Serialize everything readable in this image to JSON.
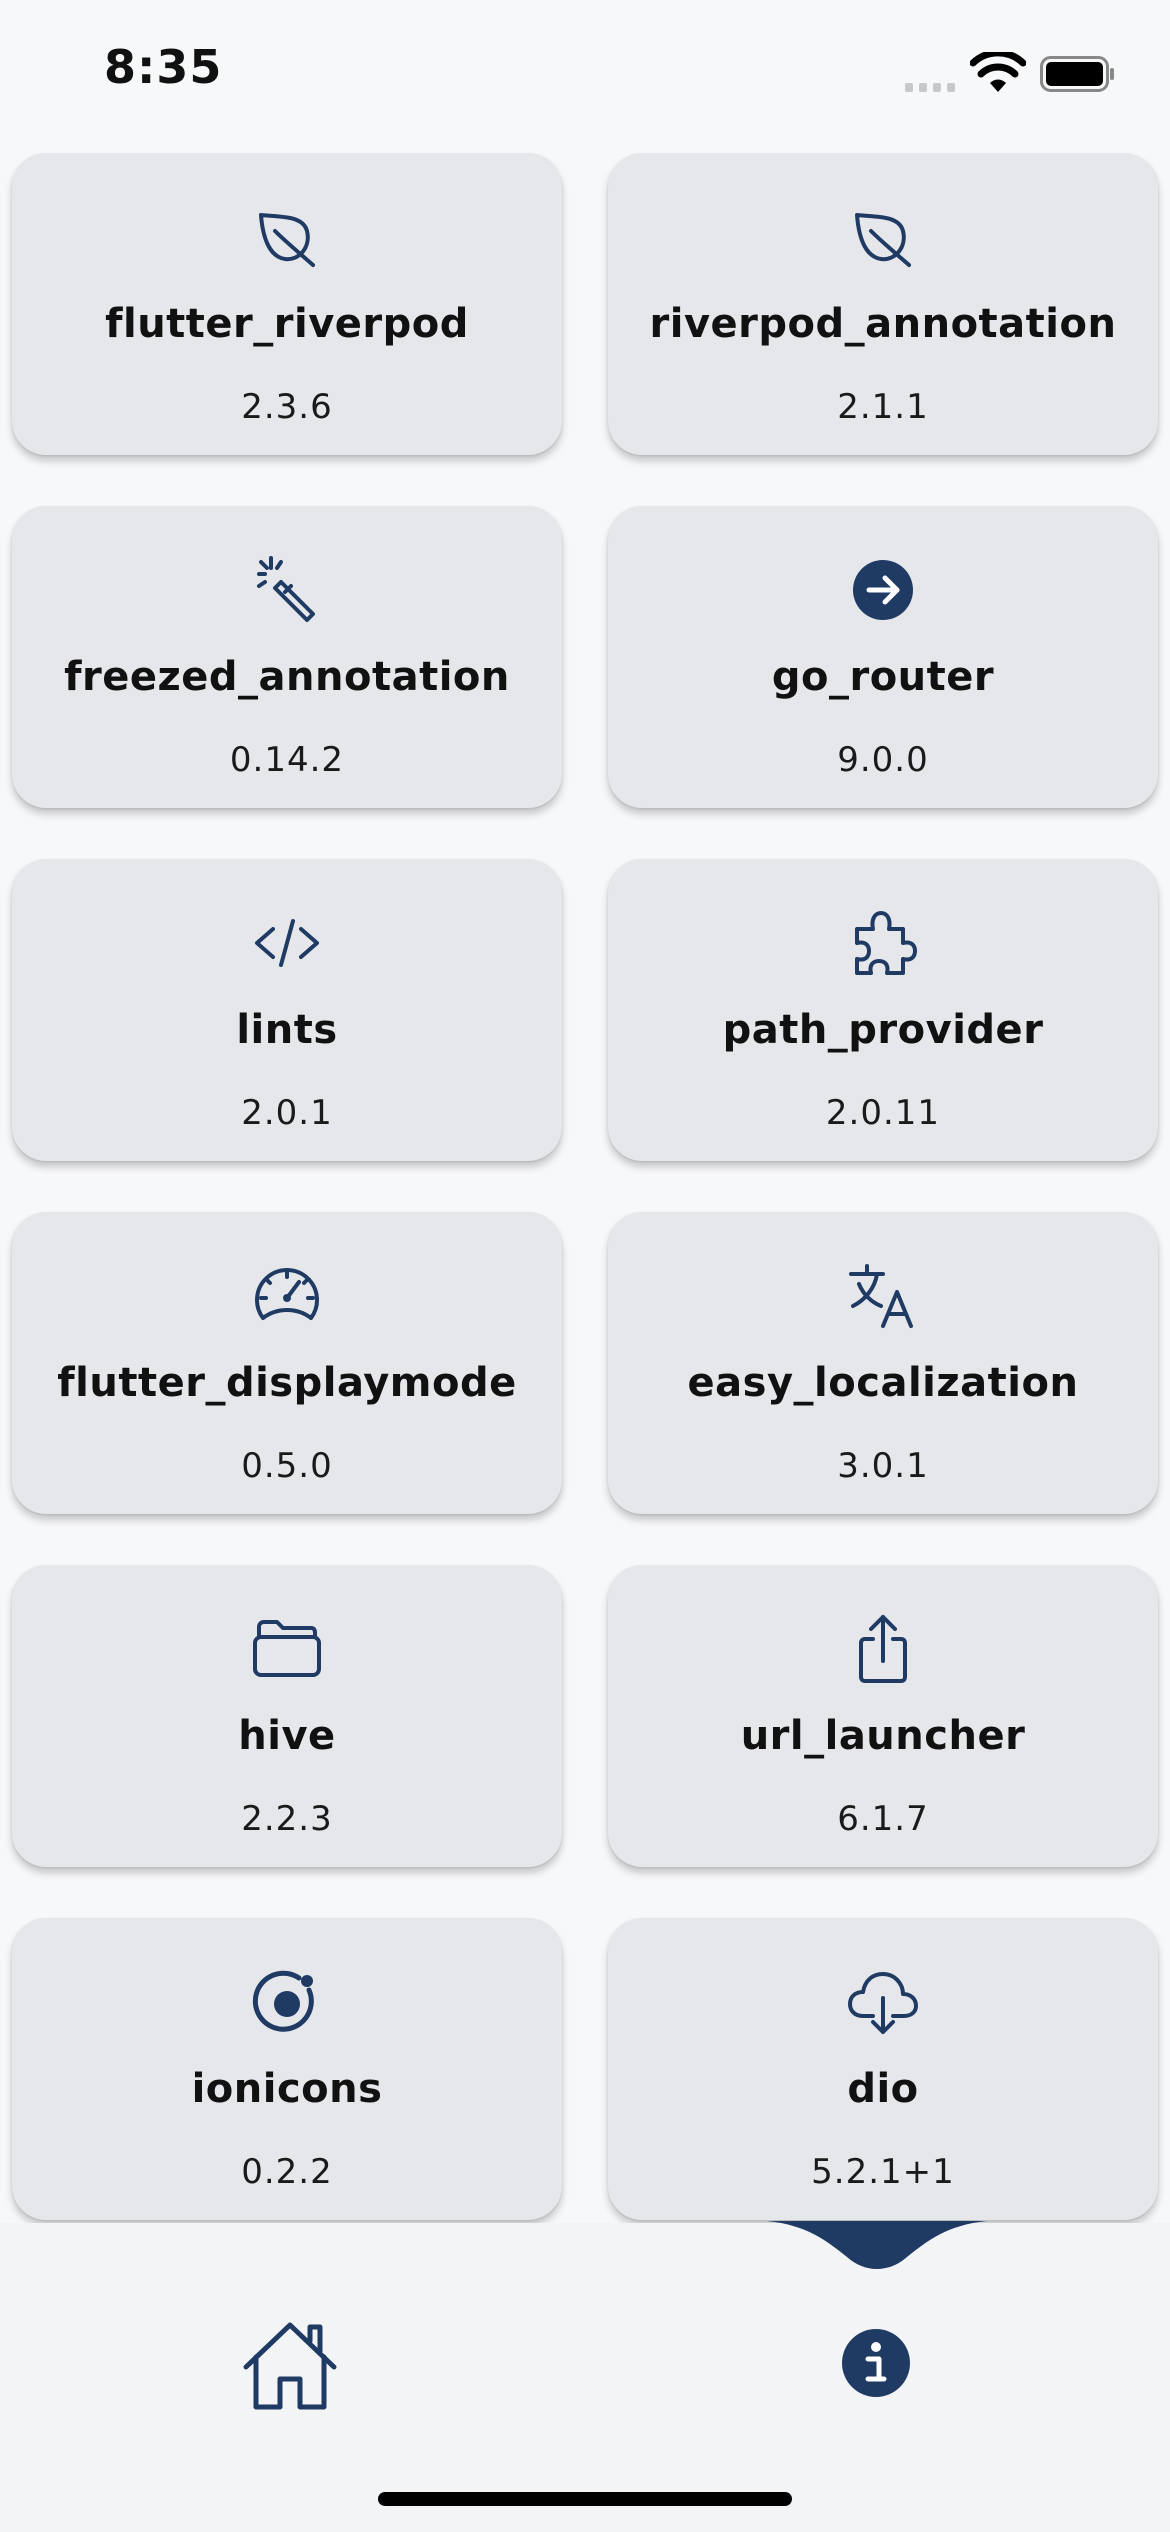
{
  "status_bar": {
    "time": "8:35"
  },
  "packages": [
    {
      "icon": "leaf-icon",
      "name": "flutter_riverpod",
      "version": "2.3.6"
    },
    {
      "icon": "leaf-icon",
      "name": "riverpod_annotation",
      "version": "2.1.1"
    },
    {
      "icon": "magic-wand-icon",
      "name": "freezed_annotation",
      "version": "0.14.2"
    },
    {
      "icon": "arrow-forward-circle-icon",
      "name": "go_router",
      "version": "9.0.0"
    },
    {
      "icon": "code-slash-icon",
      "name": "lints",
      "version": "2.0.1"
    },
    {
      "icon": "puzzle-icon",
      "name": "path_provider",
      "version": "2.0.11"
    },
    {
      "icon": "speedometer-icon",
      "name": "flutter_displaymode",
      "version": "0.5.0"
    },
    {
      "icon": "translate-icon",
      "name": "easy_localization",
      "version": "3.0.1"
    },
    {
      "icon": "folder-open-icon",
      "name": "hive",
      "version": "2.2.3"
    },
    {
      "icon": "share-icon",
      "name": "url_launcher",
      "version": "6.1.7"
    },
    {
      "icon": "ionic-logo-icon",
      "name": "ionicons",
      "version": "0.2.2"
    },
    {
      "icon": "cloud-download-icon",
      "name": "dio",
      "version": "5.2.1+1"
    }
  ],
  "nav": {
    "items": [
      {
        "icon": "home-icon",
        "selected": false
      },
      {
        "icon": "info-icon",
        "selected": true
      }
    ]
  },
  "colors": {
    "accent": "#1f3a63",
    "card_background": "#e5e7eb",
    "page_background": "#f7f8fa",
    "nav_background": "#f3f4f6"
  }
}
